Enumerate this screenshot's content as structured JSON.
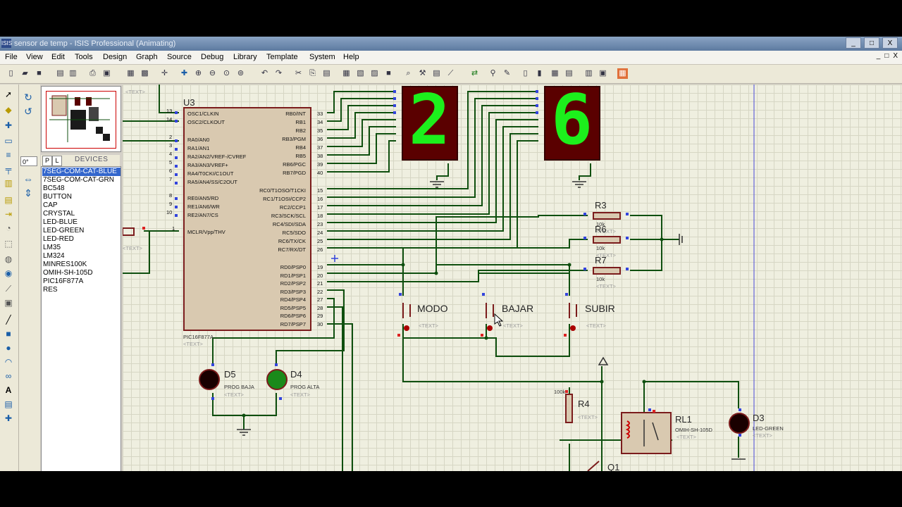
{
  "window": {
    "title": "sensor de temp - ISIS Professional (Animating)",
    "app_icon": "isis",
    "controls": [
      "_",
      "□",
      "X"
    ]
  },
  "menu": {
    "items": [
      "File",
      "View",
      "Edit",
      "Tools",
      "Design",
      "Graph",
      "Source",
      "Debug",
      "Library",
      "Template",
      "System",
      "Help"
    ],
    "inner_controls": [
      "_",
      "□",
      "X"
    ]
  },
  "panel": {
    "tab_p": "P",
    "tab_l": "L",
    "devices_title": "DEVICES",
    "angle_value": "0°",
    "devices": [
      "7SEG-COM-CAT-BLUE",
      "7SEG-COM-CAT-GRN",
      "BC548",
      "BUTTON",
      "CAP",
      "CRYSTAL",
      "LED-BLUE",
      "LED-GREEN",
      "LED-RED",
      "LM35",
      "LM324",
      "MINRES100K",
      "OMIH-SH-105D",
      "PIC16F877A",
      "RES"
    ],
    "selected_device": "7SEG-COM-CAT-BLUE"
  },
  "schematic": {
    "mcu": {
      "ref": "U3",
      "part": "PIC16F877A",
      "text_placeholder": "<TEXT>",
      "left_pins": [
        {
          "num": "13",
          "name": "OSC1/CLKIN"
        },
        {
          "num": "14",
          "name": "OSC2/CLKOUT"
        },
        {
          "num": "2",
          "name": "RA0/AN0"
        },
        {
          "num": "3",
          "name": "RA1/AN1"
        },
        {
          "num": "4",
          "name": "RA2/AN2/VREF-/CVREF"
        },
        {
          "num": "5",
          "name": "RA3/AN3/VREF+"
        },
        {
          "num": "6",
          "name": "RA4/T0CKI/C1OUT"
        },
        {
          "num": "7",
          "name": "RA5/AN4/SS/C2OUT"
        },
        {
          "num": "8",
          "name": "RE0/AN5/RD"
        },
        {
          "num": "9",
          "name": "RE1/AN6/WR"
        },
        {
          "num": "10",
          "name": "RE2/AN7/CS"
        },
        {
          "num": "1",
          "name": "MCLR/Vpp/THV"
        }
      ],
      "right_pins": [
        {
          "num": "33",
          "name": "RB0/INT"
        },
        {
          "num": "34",
          "name": "RB1"
        },
        {
          "num": "35",
          "name": "RB2"
        },
        {
          "num": "36",
          "name": "RB3/PGM"
        },
        {
          "num": "37",
          "name": "RB4"
        },
        {
          "num": "38",
          "name": "RB5"
        },
        {
          "num": "39",
          "name": "RB6/PGC"
        },
        {
          "num": "40",
          "name": "RB7/PGD"
        },
        {
          "num": "15",
          "name": "RC0/T1OSO/T1CKI"
        },
        {
          "num": "16",
          "name": "RC1/T1OSI/CCP2"
        },
        {
          "num": "17",
          "name": "RC2/CCP1"
        },
        {
          "num": "18",
          "name": "RC3/SCK/SCL"
        },
        {
          "num": "23",
          "name": "RC4/SDI/SDA"
        },
        {
          "num": "24",
          "name": "RC5/SDO"
        },
        {
          "num": "25",
          "name": "RC6/TX/CK"
        },
        {
          "num": "26",
          "name": "RC7/RX/DT"
        },
        {
          "num": "19",
          "name": "RD0/PSP0"
        },
        {
          "num": "20",
          "name": "RD1/PSP1"
        },
        {
          "num": "21",
          "name": "RD2/PSP2"
        },
        {
          "num": "22",
          "name": "RD3/PSP3"
        },
        {
          "num": "27",
          "name": "RD4/PSP4"
        },
        {
          "num": "28",
          "name": "RD5/PSP5"
        },
        {
          "num": "29",
          "name": "RD6/PSP6"
        },
        {
          "num": "30",
          "name": "RD7/PSP7"
        }
      ]
    },
    "displays": [
      {
        "digit": "2",
        "color": "#1cf01c"
      },
      {
        "digit": "6",
        "color": "#1cf01c"
      }
    ],
    "resistors": [
      {
        "ref": "R3",
        "value": "10k",
        "text": "<TEXT>"
      },
      {
        "ref": "R6",
        "value": "10k",
        "text": "<TEXT>"
      },
      {
        "ref": "R7",
        "value": "10k",
        "text": "<TEXT>"
      },
      {
        "ref": "R4",
        "value": "100k",
        "text": "<TEXT>"
      }
    ],
    "buttons": [
      {
        "label": "MODO",
        "text": "<TEXT>"
      },
      {
        "label": "BAJAR",
        "text": "<TEXT>"
      },
      {
        "label": "SUBIR",
        "text": "<TEXT>"
      }
    ],
    "leds": [
      {
        "ref": "D5",
        "name": "PROG BAJA",
        "text": "<TEXT>",
        "color": "#1a0000"
      },
      {
        "ref": "D4",
        "name": "PROG ALTA",
        "text": "<TEXT>",
        "color": "#1a8a1a"
      },
      {
        "ref": "D3",
        "name": "LED-GREEN",
        "text": "<TEXT>",
        "color": "#1a0000"
      }
    ],
    "relay": {
      "ref": "RL1",
      "part": "OMIH-SH-105D",
      "text": "<TEXT>"
    },
    "transistor": {
      "ref": "Q1"
    },
    "misc_text": [
      "<TEXT>",
      "<TEXT>"
    ],
    "colors": {
      "wire": "#0f4f0f",
      "component": "#7b1c1c",
      "pin_blue": "#3344dd",
      "pin_red": "#dd2222",
      "segment_on": "#1cf01c"
    }
  }
}
